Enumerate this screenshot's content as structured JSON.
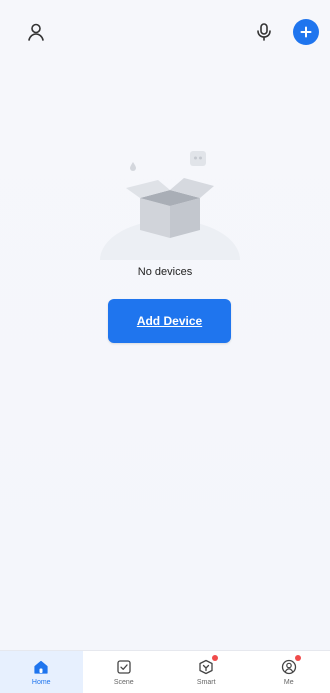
{
  "topbar": {
    "icons": [
      "person-icon",
      "microphone-icon",
      "plus-icon"
    ],
    "accent": "#1f75ee"
  },
  "empty_state": {
    "message": "No devices",
    "button_label": "Add Device"
  },
  "tabs": [
    {
      "label": "Home",
      "icon": "home-icon",
      "active": true,
      "badge": false
    },
    {
      "label": "Scene",
      "icon": "checkbox-icon",
      "active": false,
      "badge": false
    },
    {
      "label": "Smart",
      "icon": "smart-icon",
      "active": false,
      "badge": true
    },
    {
      "label": "Me",
      "icon": "user-circle-icon",
      "active": false,
      "badge": true
    }
  ],
  "colors": {
    "background": "#f4f6fb",
    "primary": "#1f75ee",
    "badge": "#f04b4b"
  }
}
